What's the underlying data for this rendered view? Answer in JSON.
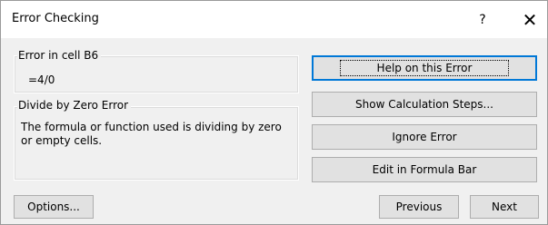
{
  "window": {
    "title": "Error Checking",
    "help_glyph": "?",
    "close_glyph": "✕"
  },
  "error_cell": {
    "label": "Error in cell B6",
    "formula": "=4/0"
  },
  "error_info": {
    "label": "Divide by Zero Error",
    "description": "The formula or function used is dividing by zero or empty cells."
  },
  "buttons": {
    "help": "Help on this Error",
    "steps": "Show Calculation Steps...",
    "ignore": "Ignore Error",
    "edit": "Edit in Formula Bar",
    "options": "Options...",
    "previous": "Previous",
    "next": "Next"
  }
}
